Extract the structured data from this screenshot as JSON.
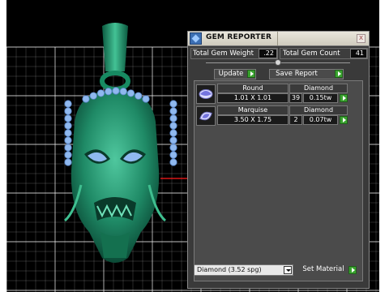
{
  "panel": {
    "title": "GEM REPORTER",
    "close_glyph": "x",
    "total_weight_label": "Total Gem Weight",
    "total_weight_value": ".22",
    "total_count_label": "Total Gem Count",
    "total_count_value": "41",
    "update_label": "Update",
    "save_report_label": "Save Report",
    "gems": [
      {
        "shape": "Round",
        "material": "Diamond",
        "size": "1.01 X 1.01",
        "count": "39",
        "weight": "0.15tw"
      },
      {
        "shape": "Marquise",
        "material": "Diamond",
        "size": "3.50 X 1.75",
        "count": "2",
        "weight": "0.07tw"
      }
    ],
    "material_select": "Diamond   (3.52 spg)",
    "set_material_label": "Set Material"
  },
  "colors": {
    "pendant": "#1f8a66",
    "gem": "#8fb8ee",
    "grid": "#ffffff",
    "axis": "#ff1b1b",
    "play_button": "#3aa32f"
  },
  "icons": {
    "app": "gem-reporter-icon",
    "close": "close-icon",
    "play": "play-arrow-icon",
    "dropdown": "chevron-down-icon",
    "round_gem": "round-gem-icon",
    "marquise_gem": "marquise-gem-icon"
  }
}
